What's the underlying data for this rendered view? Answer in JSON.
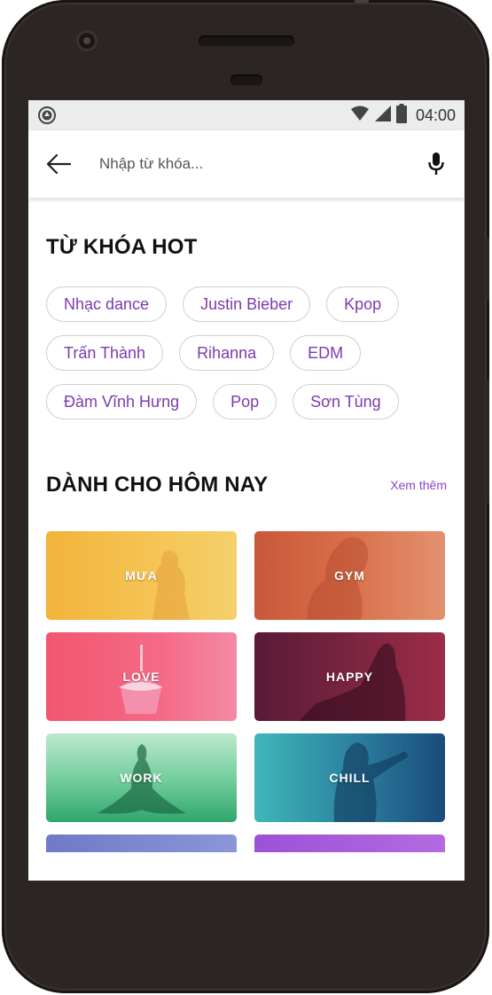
{
  "status_bar": {
    "time": "04:00"
  },
  "search": {
    "placeholder": "Nhập từ khóa..."
  },
  "hot_keywords": {
    "title": "TỪ KHÓA HOT",
    "chips": [
      "Nhạc dance",
      "Justin Bieber",
      "Kpop",
      "Trấn Thành",
      "Rihanna",
      "EDM",
      "Đàm Vĩnh Hưng",
      "Pop",
      "Sơn Tùng"
    ]
  },
  "today": {
    "title": "DÀNH CHO HÔM NAY",
    "see_more": "Xem thêm",
    "cards": [
      "MƯA",
      "GYM",
      "LOVE",
      "HAPPY",
      "WORK",
      "CHILL"
    ]
  },
  "colors": {
    "accent": "#7b3bb0",
    "chip_border": "#cfcfcf",
    "status_bar_bg": "#ececec"
  },
  "icons": [
    "location-icon",
    "wifi-icon",
    "signal-icon",
    "battery-icon",
    "back-arrow-icon",
    "microphone-icon"
  ]
}
